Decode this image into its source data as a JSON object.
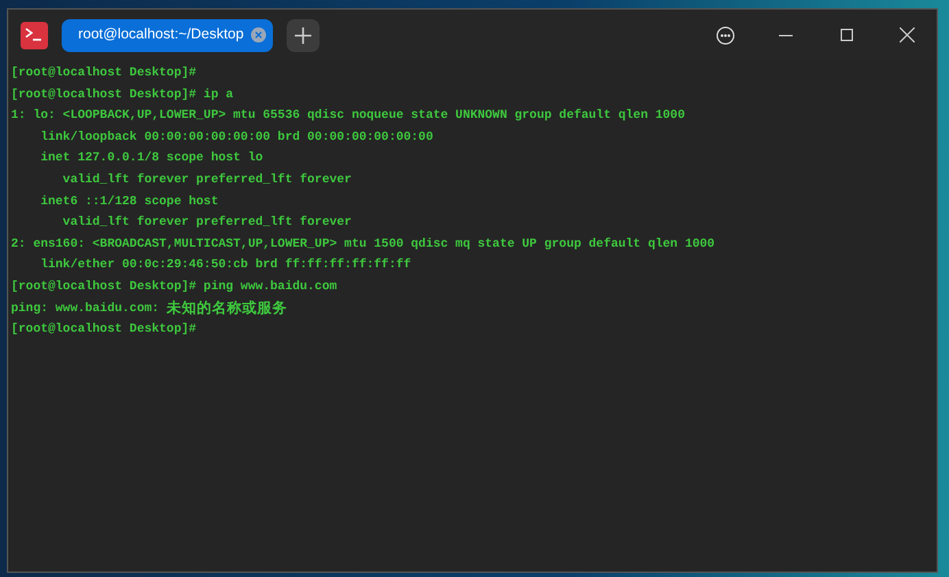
{
  "window": {
    "tabs": [
      {
        "label": "root@localhost:~/Desktop",
        "selected": true
      }
    ]
  },
  "terminal": {
    "lines": [
      "[root@localhost Desktop]#",
      "[root@localhost Desktop]# ip a",
      "1: lo: <LOOPBACK,UP,LOWER_UP> mtu 65536 qdisc noqueue state UNKNOWN group default qlen 1000",
      "    link/loopback 00:00:00:00:00:00 brd 00:00:00:00:00:00",
      "    inet 127.0.0.1/8 scope host lo",
      "       valid_lft forever preferred_lft forever",
      "    inet6 ::1/128 scope host",
      "       valid_lft forever preferred_lft forever",
      "2: ens160: <BROADCAST,MULTICAST,UP,LOWER_UP> mtu 1500 qdisc mq state UP group default qlen 1000",
      "    link/ether 00:0c:29:46:50:cb brd ff:ff:ff:ff:ff:ff",
      "[root@localhost Desktop]# ping www.baidu.com",
      "ping: www.baidu.com: 未知的名称或服务",
      "[root@localhost Desktop]#"
    ]
  }
}
